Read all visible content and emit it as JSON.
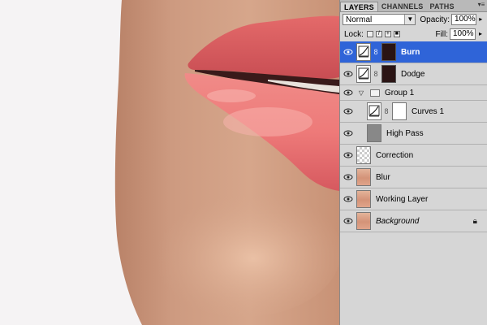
{
  "photo": {
    "description_colors": {
      "skin": "#c89478",
      "lip": "#ea6f72",
      "background": "#f5f3f4"
    }
  },
  "panel": {
    "tabs": [
      {
        "label": "LAYERS",
        "active": true
      },
      {
        "label": "CHANNELS",
        "active": false
      },
      {
        "label": "PATHS",
        "active": false
      }
    ],
    "blend_mode": "Normal",
    "opacity_label": "Opacity:",
    "opacity_value": "100%",
    "lock_label": "Lock:",
    "fill_label": "Fill:",
    "fill_value": "100%",
    "layers": [
      {
        "name": "Burn",
        "selected": true
      },
      {
        "name": "Dodge",
        "selected": false
      },
      {
        "name": "Group 1",
        "selected": false
      },
      {
        "name": "Curves 1",
        "selected": false
      },
      {
        "name": "High Pass",
        "selected": false
      },
      {
        "name": "Correction",
        "selected": false
      },
      {
        "name": "Blur",
        "selected": false
      },
      {
        "name": "Working Layer",
        "selected": false
      },
      {
        "name": "Background",
        "selected": false
      }
    ]
  },
  "colors": {
    "selection": "#2f64d8",
    "panel_bg": "#d6d6d6"
  }
}
